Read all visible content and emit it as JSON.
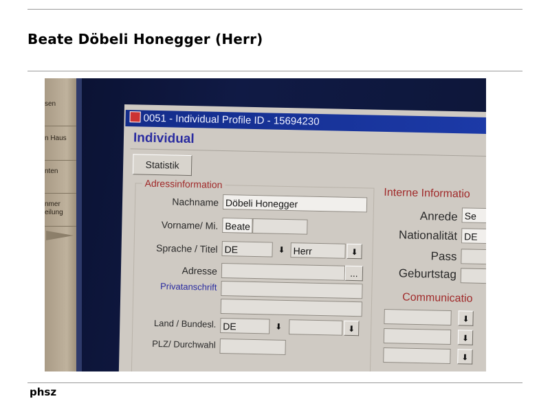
{
  "page": {
    "title": "Beate Döbeli Honegger (Herr)",
    "footer": "phsz"
  },
  "screen": {
    "side_buttons": [
      "sen",
      "n Haus",
      "nten",
      "nmer\neilung"
    ],
    "window_title": "0051 - Individual Profile ID - 15694230",
    "section_title": "Individual",
    "statistik_button": "Statistik",
    "address_group": {
      "legend": "Adressinformation",
      "nachname_label": "Nachname",
      "nachname_value": "Döbeli Honegger",
      "vorname_label": "Vorname/ Mi.",
      "vorname_value": "Beate",
      "sprache_label": "Sprache / Titel",
      "sprache_value": "DE",
      "titel_value": "Herr",
      "adresse_label": "Adresse",
      "adresse_button": "...",
      "privat_label": "Privatanschrift",
      "land_label": "Land / Bundesl.",
      "land_value": "DE",
      "plz_label": "PLZ/ Durchwahl"
    },
    "interne_group": {
      "legend": "Interne Informatio",
      "anrede_label": "Anrede",
      "anrede_value": "Se",
      "nationalitaet_label": "Nationalität",
      "nationalitaet_value": "DE",
      "pass_label": "Pass",
      "geburtstag_label": "Geburtstag"
    },
    "communication_legend": "Communicatio",
    "dropdown_icon": "download-arrow-icon",
    "dropdown_glyph": "⬇"
  }
}
